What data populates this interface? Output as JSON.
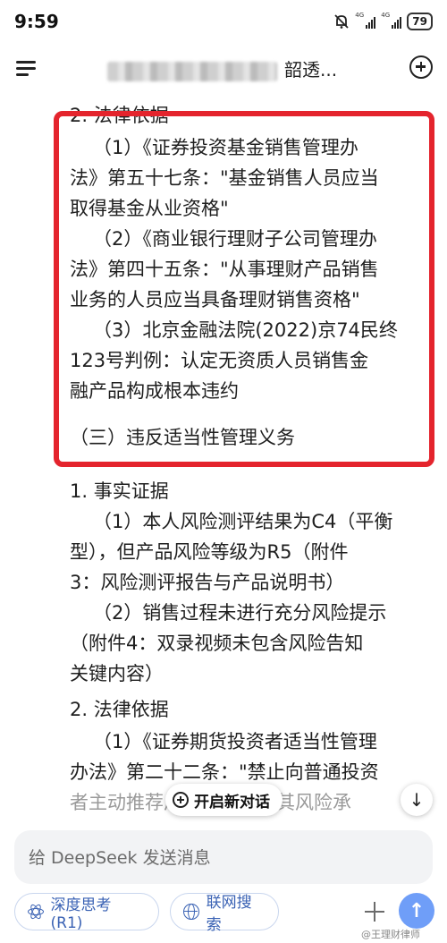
{
  "status_bar": {
    "time": "9:59",
    "net1": "4G",
    "net2": "4G",
    "battery": "79"
  },
  "header": {
    "title_suffix": "韶透..."
  },
  "content": {
    "lines": [
      "2. 法律依据",
      "（1）《证券投资基金销售管理办",
      "法》第五十七条：\"基金销售人员应当",
      "取得基金从业资格\"",
      "（2）《商业银行理财子公司管理办",
      "法》第四十五条：\"从事理财产品销售",
      "业务的人员应当具备理财销售资格\"",
      "（3）北京金融法院(2022)京74民终",
      "123号判例：认定无资质人员销售金",
      "融产品构成根本违约",
      "（三）违反适当性管理义务",
      "1. 事实证据",
      "（1）本人风险测评结果为C4（平衡",
      "型），但产品风险等级为R5（附件",
      "3：风险测评报告与产品说明书）",
      "（2）销售过程未进行充分风险提示",
      "（附件4：双录视频未包含风险告知",
      "关键内容）",
      "2. 法律依据",
      "（1）《证券期货投资者适当性管理",
      "办法》第二十二条：\"禁止向普通投资",
      "者主动推荐风险等级高于其风险承"
    ]
  },
  "floating": {
    "new_dialog_label": "开启新对话"
  },
  "input": {
    "placeholder": "给 DeepSeek 发送消息"
  },
  "toolbar": {
    "deep_think_label": "深度思考 (R1)",
    "web_search_label": "联网搜索"
  },
  "watermark": "@王理财律师",
  "colors": {
    "highlight_frame": "#e4242d",
    "accent": "#3a62b4",
    "send_button": "#6f9ef8"
  }
}
